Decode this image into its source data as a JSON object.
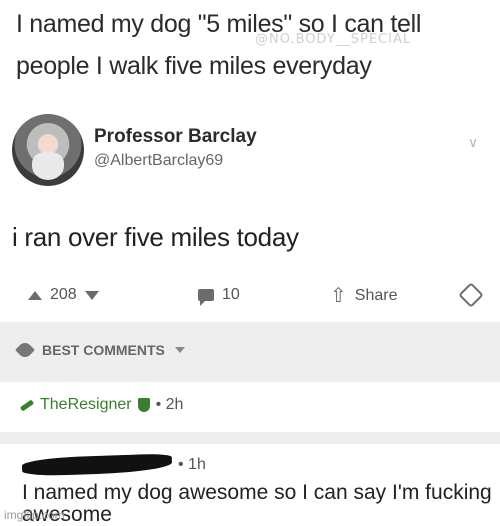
{
  "header": {
    "line1": "I named my dog \"5 miles\" so I can tell",
    "line2": "people I walk five miles everyday",
    "watermark": "@NO.BODY__SPECIAL"
  },
  "post": {
    "author_name": "Professor Barclay",
    "author_handle": "@AlbertBarclay69",
    "body": "i ran over five miles today",
    "upvotes": "208",
    "comments": "10",
    "share_label": "Share",
    "icons": [
      "upvote-icon",
      "downvote-icon",
      "comment-icon",
      "share-icon",
      "award-icon",
      "chevron-down-icon"
    ]
  },
  "comments_section": {
    "sort_label": "BEST COMMENTS",
    "comment1": {
      "author": "TheResigner",
      "time": "• 2h"
    },
    "comment2": {
      "time": "• 1h",
      "body": "I named my dog awesome so I can say I'm fucking awesome"
    }
  },
  "footer": {
    "watermark": "imgflip.com"
  },
  "colors": {
    "green": "#3a7f2f",
    "band_gray": "#eeeeee"
  }
}
